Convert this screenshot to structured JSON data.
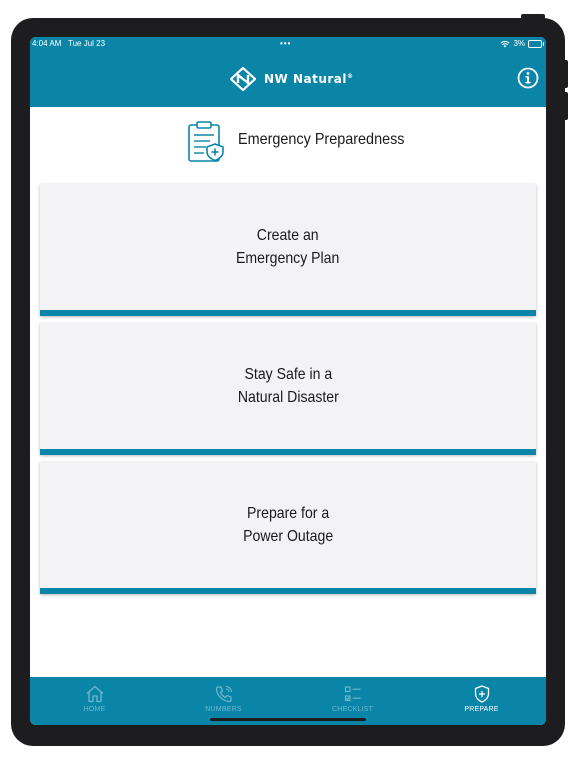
{
  "status_bar": {
    "time": "4:04 AM",
    "date": "Tue Jul 23",
    "dots": "•••",
    "battery": "3%"
  },
  "header": {
    "brand_name": "NW Natural",
    "brand_mark": "®",
    "info_icon": "info-icon"
  },
  "page": {
    "title": "Emergency Preparedness",
    "title_icon": "clipboard-shield-icon"
  },
  "cards": [
    {
      "line1": "Create an",
      "line2": "Emergency Plan"
    },
    {
      "line1": "Stay Safe in a",
      "line2": "Natural Disaster"
    },
    {
      "line1": "Prepare for a",
      "line2": "Power Outage"
    }
  ],
  "tabs": [
    {
      "label": "HOME",
      "icon": "home-icon",
      "active": false
    },
    {
      "label": "NUMBERS",
      "icon": "phone-icon",
      "active": false
    },
    {
      "label": "CHECKLIST",
      "icon": "checklist-icon",
      "active": false
    },
    {
      "label": "PREPARE",
      "icon": "shield-plus-icon",
      "active": true
    }
  ],
  "colors": {
    "brand_teal": "#0a85a8",
    "card_bg": "#f3f3f6",
    "inactive_tab": "#6fb9cf",
    "device_frame": "#1d1d1f"
  }
}
